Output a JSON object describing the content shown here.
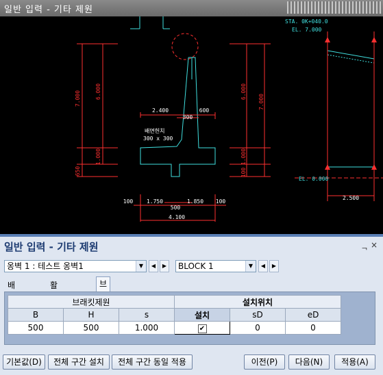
{
  "window": {
    "title": "일반 입력 - 기타 제원"
  },
  "drawing": {
    "sta": "STA. 0K+040.0",
    "el_top": "EL. 7.000",
    "el_bottom": "EL. 0.000",
    "dims": {
      "d7000_left": "7.000",
      "d6000_left": "6.000",
      "d1000_left": "1.000",
      "d650": "650",
      "d6000_right": "6.000",
      "d7000_right": "7.000",
      "d1000_right": "1.000",
      "d100_right": "100",
      "d2400": "2.400",
      "d600": "600",
      "d300": "300",
      "d100_a": "100",
      "d1750": "1.750",
      "d1850": "1.850",
      "d100_b": "100",
      "d500": "500",
      "d4100": "4.100",
      "d2500": "2.500"
    },
    "label_haunch": "배면헌치",
    "label_haunch_size": "300 x 300"
  },
  "panel": {
    "title": "일반 입력 - 기타 제원",
    "pin": "ᆨ",
    "close": "×",
    "combo_wall": "옹벽 1 : 테스트 옹벽1",
    "combo_block": "BLOCK  1",
    "tabs": [
      "배면헌치",
      "활동방지벽",
      "브래킷"
    ],
    "active_tab": 2,
    "grid": {
      "group1": "브래킷제원",
      "group2": "설치위치",
      "cols": [
        "B",
        "H",
        "s",
        "설치",
        "sD",
        "eD"
      ],
      "row": [
        "500",
        "500",
        "1.000",
        "",
        "0",
        "0"
      ],
      "installed": true
    },
    "buttons": {
      "default": "기본값(D)",
      "all_install": "전체 구간 설치",
      "all_same": "전체 구간 동일 적용",
      "prev": "이전(P)",
      "next": "다음(N)",
      "apply": "적용(A)"
    }
  }
}
